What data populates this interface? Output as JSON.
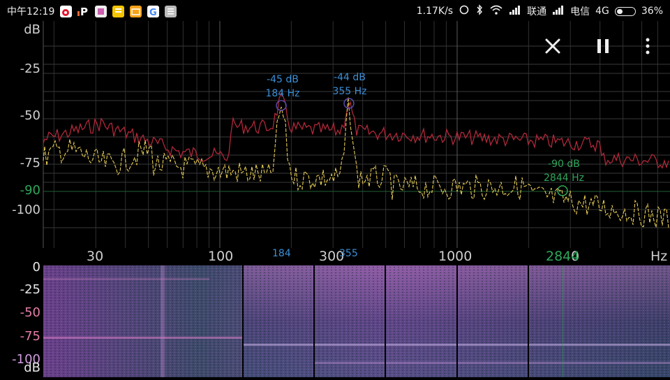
{
  "status_bar": {
    "time": "中午12:19",
    "app_icons": [
      "weibo-icon",
      "p-icon",
      "app-icon",
      "note-icon",
      "mail-icon",
      "google-icon",
      "doc-icon"
    ],
    "network_speed": "1.17K/s",
    "carrier1": "联通",
    "carrier2": "电信",
    "network_type": "4G",
    "battery": "36%",
    "battery_level": 0.36
  },
  "spectrum": {
    "y_unit": "dB",
    "y_ticks": [
      "-25",
      "-50",
      "-75",
      "-100"
    ],
    "cursor_y_tick": "-90",
    "x_ticks": [
      "30",
      "100",
      "300",
      "1000"
    ],
    "x_cursor_tick": "2844",
    "x_partial_tick": "0",
    "x_unit": "Hz",
    "peak_freq_ticks": [
      "184",
      "355"
    ],
    "peaks": [
      {
        "db": "-45 dB",
        "hz": "184 Hz"
      },
      {
        "db": "-44 dB",
        "hz": "355 Hz"
      }
    ],
    "cursor": {
      "db": "-90 dB",
      "hz": "2844 Hz"
    },
    "colors": {
      "peak_trace": "#b0283a",
      "live_trace": "#e6cc55",
      "peak_label": "#3a8fd8",
      "cursor": "#2fa65a"
    }
  },
  "toolbar": {
    "close_icon": "close-icon",
    "pause_icon": "pause-icon",
    "menu_icon": "more-vert-icon"
  },
  "spectrogram": {
    "db_ticks": [
      "0",
      "-25",
      "-50",
      "-75",
      "-100"
    ],
    "db_unit": "dB",
    "colors": {
      "background": "#2a3a52",
      "mid": "#6a4a9a",
      "high": "#e090d0"
    }
  }
}
